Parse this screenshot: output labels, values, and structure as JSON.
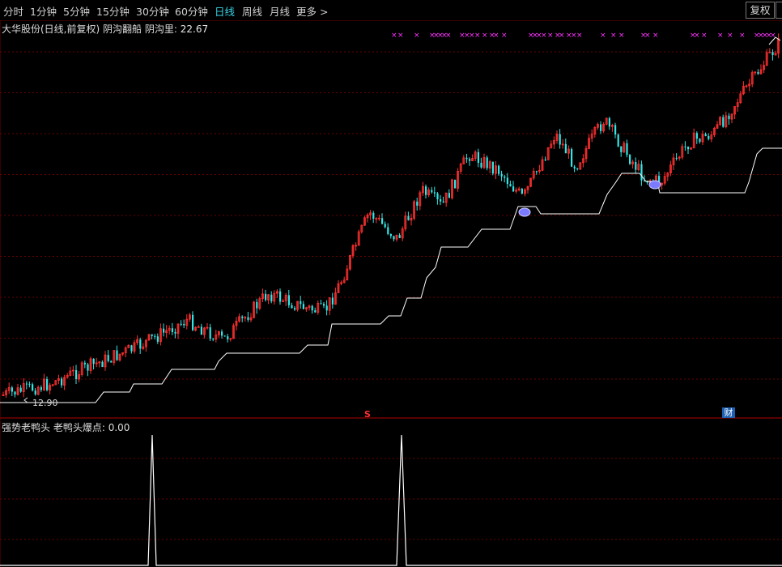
{
  "toolbar": {
    "periods": [
      "分时",
      "1分钟",
      "5分钟",
      "15分钟",
      "30分钟",
      "60分钟",
      "日线",
      "周线",
      "月线"
    ],
    "active_period": "日线",
    "more_label": "更多 >",
    "fuquan_label": "复权"
  },
  "main_chart": {
    "title": "大华股份(日线,前复权)",
    "indicator_name": "阴沟翻船",
    "indicator_label": "阴沟里:",
    "indicator_value": "22.67",
    "low_price_label": "12.90",
    "marker_s": "S",
    "marker_cai": "财",
    "colors": {
      "up": "#ff3030",
      "down": "#32e6e6",
      "line": "#ffffff",
      "x_marks": "#ff33ff",
      "grid": "#6a0000"
    }
  },
  "sub_chart": {
    "title": "强势老鸭头",
    "indicator_label": "老鸭头爆点:",
    "indicator_value": "0.00"
  },
  "chart_data": {
    "type": "candlestick",
    "series": [
      {
        "name": "阴沟里",
        "type": "step_line"
      },
      {
        "name": "老鸭头爆点",
        "type": "spike",
        "values": [
          0,
          1,
          0,
          1,
          0
        ]
      }
    ]
  }
}
